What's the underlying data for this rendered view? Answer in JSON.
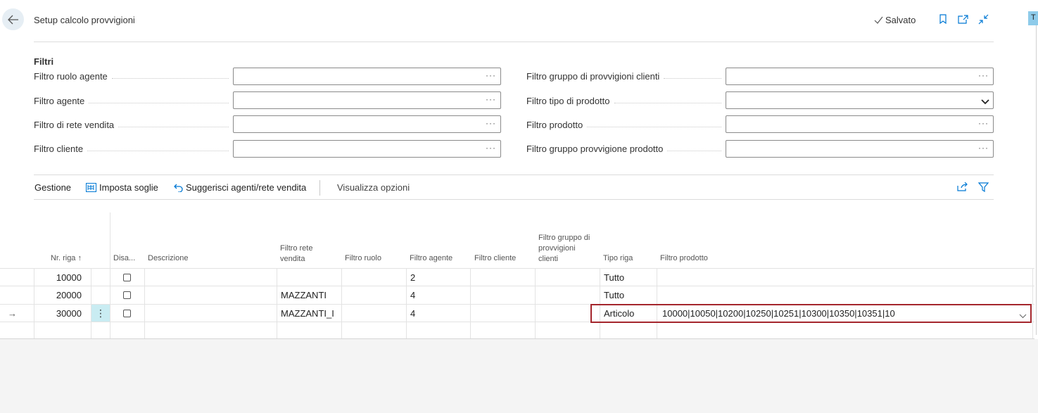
{
  "header": {
    "title": "Setup calcolo provvigioni",
    "saved_label": "Salvato",
    "corner_tab": "T"
  },
  "filters": {
    "section_title": "Filtri",
    "left": [
      {
        "label": "Filtro ruolo agente",
        "value": "",
        "control": "lookup"
      },
      {
        "label": "Filtro agente",
        "value": "",
        "control": "lookup"
      },
      {
        "label": "Filtro di rete vendita",
        "value": "",
        "control": "lookup"
      },
      {
        "label": "Filtro cliente",
        "value": "",
        "control": "lookup"
      }
    ],
    "right": [
      {
        "label": "Filtro gruppo di provvigioni clienti",
        "value": "",
        "control": "lookup"
      },
      {
        "label": "Filtro tipo di prodotto",
        "value": "",
        "control": "dropdown"
      },
      {
        "label": "Filtro prodotto",
        "value": "",
        "control": "lookup"
      },
      {
        "label": "Filtro gruppo provvigione prodotto",
        "value": "",
        "control": "lookup"
      }
    ]
  },
  "actions": {
    "gestione": "Gestione",
    "imposta_soglie": "Imposta soglie",
    "suggerisci": "Suggerisci agenti/rete vendita",
    "visualizza_opzioni": "Visualizza opzioni"
  },
  "grid": {
    "columns": {
      "nr_riga": "Nr. riga",
      "disabilitato": "Disa...",
      "descrizione": "Descrizione",
      "filtro_rete_vendita": "Filtro rete vendita",
      "filtro_ruolo": "Filtro ruolo",
      "filtro_agente": "Filtro agente",
      "filtro_cliente": "Filtro cliente",
      "filtro_gruppo_provvigioni_clienti": "Filtro gruppo di provvigioni clienti",
      "tipo_riga": "Tipo riga",
      "filtro_prodotto": "Filtro prodotto"
    },
    "sort_indicator": "↑",
    "rows": [
      {
        "nr_riga": "10000",
        "disabilitato": false,
        "descrizione": "",
        "filtro_rete_vendita": "",
        "filtro_ruolo": "",
        "filtro_agente": "2",
        "filtro_cliente": "",
        "filtro_gruppo": "",
        "tipo_riga": "Tutto",
        "filtro_prodotto": ""
      },
      {
        "nr_riga": "20000",
        "disabilitato": false,
        "descrizione": "",
        "filtro_rete_vendita": "MAZZANTI",
        "filtro_ruolo": "",
        "filtro_agente": "4",
        "filtro_cliente": "",
        "filtro_gruppo": "",
        "tipo_riga": "Tutto",
        "filtro_prodotto": ""
      },
      {
        "nr_riga": "30000",
        "disabilitato": false,
        "descrizione": "",
        "filtro_rete_vendita": "MAZZANTI_I",
        "filtro_ruolo": "",
        "filtro_agente": "4",
        "filtro_cliente": "",
        "filtro_gruppo": "",
        "tipo_riga": "Articolo",
        "filtro_prodotto": "10000|10050|10200|10250|10251|10300|10350|10351|10"
      }
    ],
    "current_row_marker": "→",
    "row_menu_icon": "⋮"
  },
  "colors": {
    "accent": "#0078d4",
    "highlight_border": "#a4262c",
    "row_menu_bg": "#c9ecf2"
  }
}
